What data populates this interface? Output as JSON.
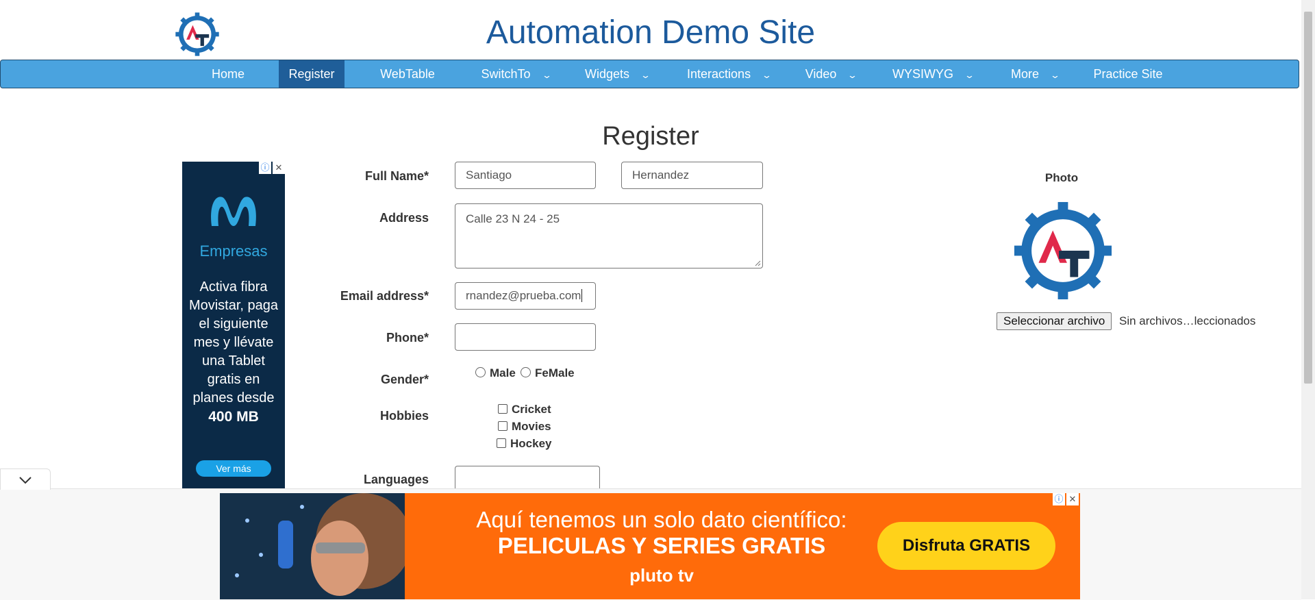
{
  "header": {
    "site_title": "Automation Demo Site"
  },
  "nav": {
    "home": "Home",
    "register": "Register",
    "webtable": "WebTable",
    "switchto": "SwitchTo",
    "widgets": "Widgets",
    "interactions": "Interactions",
    "video": "Video",
    "wysiwyg": "WYSIWYG",
    "more": "More",
    "practice": "Practice Site",
    "caret_icon": "chevron-down-icon",
    "active": "Register",
    "bar_color": "#4aa3df",
    "active_color": "#1f5e99"
  },
  "form": {
    "heading": "Register",
    "full_name_label": "Full Name*",
    "first_name_value": "Santiago",
    "last_name_value": "Hernandez",
    "address_label": "Address",
    "address_value": "Calle 23 N 24 - 25",
    "email_label": "Email address*",
    "email_value": "rnandez@prueba.com",
    "phone_label": "Phone*",
    "phone_value": "",
    "gender_label": "Gender*",
    "gender_male": "Male",
    "gender_female": "FeMale",
    "hobbies_label": "Hobbies",
    "hobby_cricket": "Cricket",
    "hobby_movies": "Movies",
    "hobby_hockey": "Hockey",
    "languages_label": "Languages"
  },
  "photo": {
    "title": "Photo",
    "file_button": "Seleccionar archivo",
    "file_status": "Sin archivos…leccionados"
  },
  "side_ad": {
    "brand": "Empresas",
    "copy_1": "Activa fibra",
    "copy_2": "Movistar, paga",
    "copy_3": "el siguiente",
    "copy_4": "mes y llévate",
    "copy_5": "una Tablet",
    "copy_6": "gratis en",
    "copy_7": "planes desde",
    "copy_8": "400 MB",
    "cta": "Ver más",
    "info_icon": "info-icon",
    "close_icon": "close-icon"
  },
  "bottom_ad": {
    "line1": "Aquí tenemos un solo dato científico:",
    "line2": "PELICULAS Y SERIES GRATIS",
    "line3": "pluto tv",
    "cta": "Disfruta GRATIS",
    "info_icon": "info-icon",
    "close_icon": "close-icon",
    "toggle_icon": "chevron-down-icon"
  }
}
